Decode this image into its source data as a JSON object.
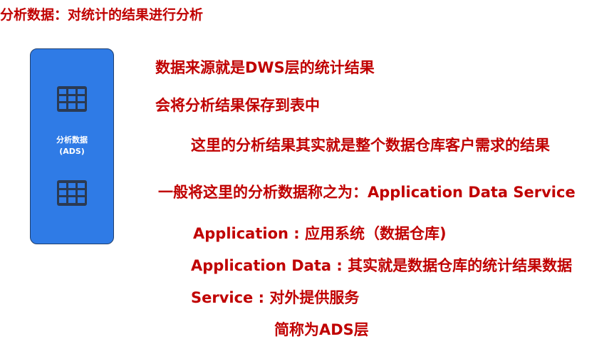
{
  "title": "分析数据：对统计的结果进行分析",
  "card": {
    "label_line1": "分析数据",
    "label_line2": "(ADS)",
    "icons": [
      "table-icon",
      "table-icon"
    ],
    "background_color": "#2f7be6"
  },
  "lines": [
    "数据来源就是DWS层的统计结果",
    "会将分析结果保存到表中",
    "这里的分析结果其实就是整个数据仓库客户需求的结果",
    "一般将这里的分析数据称之为：Application Data Service",
    "Application : 应用系统（数据仓库)",
    "Application Data : 其实就是数据仓库的统计结果数据",
    "Service : 对外提供服务",
    "简称为ADS层"
  ],
  "text_color": "#c00000"
}
